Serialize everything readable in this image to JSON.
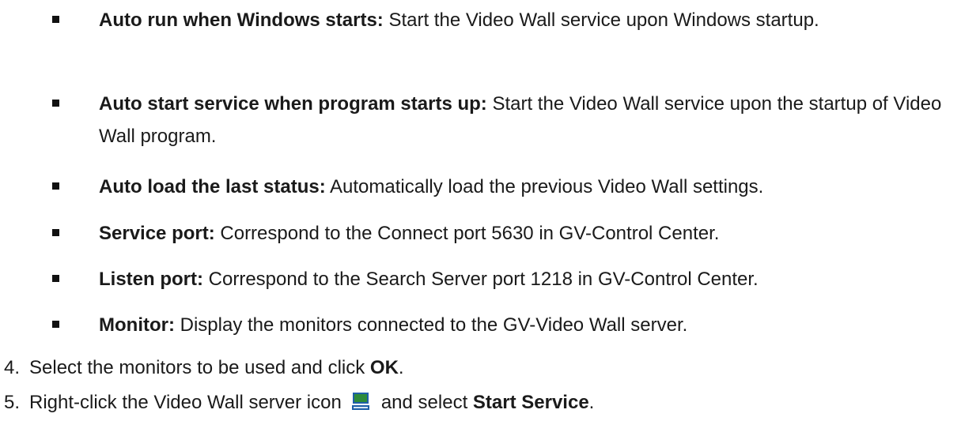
{
  "bullets": [
    {
      "term": "Auto run when Windows starts:",
      "text": " Start the Video Wall service upon Windows startup."
    },
    {
      "term": "Auto start service when program starts up:",
      "text": " Start the Video Wall service upon the startup of Video Wall program."
    },
    {
      "term": "Auto load the last status:",
      "text": " Automatically load the previous Video Wall settings."
    },
    {
      "term": "Service port:",
      "text": " Correspond to the Connect port 5630 in GV-Control Center."
    },
    {
      "term": "Listen port:",
      "text": " Correspond to the Search Server port 1218 in GV-Control Center."
    },
    {
      "term": "Monitor:",
      "text": " Display the monitors connected to the GV-Video Wall server."
    }
  ],
  "steps": [
    {
      "number": "4.",
      "text": "Select the monitors to be used and click ",
      "bold": "OK",
      "tail": "."
    },
    {
      "number": "5.",
      "text_before": "Right-click the Video Wall server icon",
      "icon": "video-wall-server-icon",
      "text_after": "and select ",
      "bold": "Start Service",
      "tail": "."
    }
  ],
  "colors": {
    "text": "#1a1a1a",
    "icon_screen": "#2e8b3a",
    "icon_frame": "#1f5fa8"
  }
}
